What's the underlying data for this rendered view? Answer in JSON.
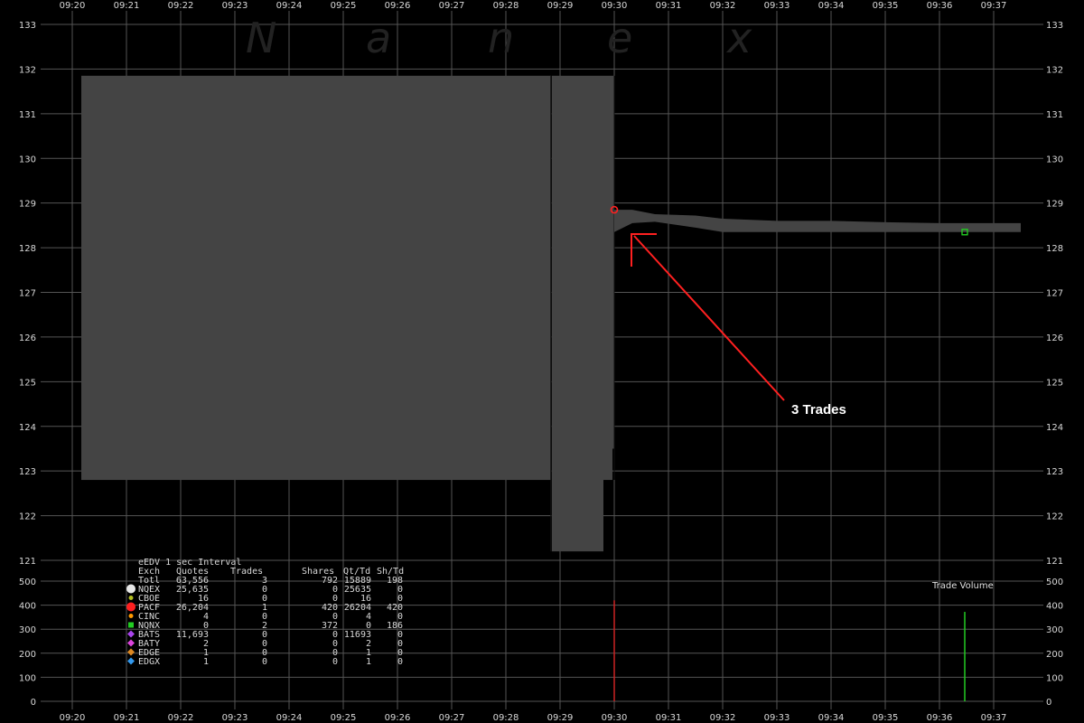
{
  "watermark": [
    "N",
    "a",
    "n",
    "e",
    "x"
  ],
  "chart_data": {
    "type": "scatter",
    "x_ticks": [
      "09:20",
      "09:21",
      "09:22",
      "09:23",
      "09:24",
      "09:25",
      "09:26",
      "09:27",
      "09:28",
      "09:29",
      "09:30",
      "09:31",
      "09:32",
      "09:33",
      "09:34",
      "09:35",
      "09:36",
      "09:37"
    ],
    "price_axis": {
      "ticks": [
        121,
        122,
        123,
        124,
        125,
        126,
        127,
        128,
        129,
        130,
        131,
        132,
        133
      ],
      "ylim": [
        120.9,
        133.2
      ]
    },
    "volume_axis": {
      "ticks": [
        0,
        100,
        200,
        300,
        400,
        500
      ],
      "ylim": [
        0,
        500
      ],
      "label": "Trade Volume"
    },
    "grid": true,
    "nbbo_spread_regions": [
      {
        "start": "09:20:10",
        "end": "09:28:50",
        "bid": 122.8,
        "ask": 131.85
      },
      {
        "start": "09:28:51",
        "end": "09:29:48",
        "bid": 121.2,
        "ask": 131.85
      },
      {
        "start": "09:29:48",
        "end": "09:29:58",
        "bid": 122.8,
        "ask": 131.85
      },
      {
        "start": "09:29:58",
        "end": "09:30:00",
        "bid": 123.5,
        "ask": 131.85
      }
    ],
    "nbbo_after_open": [
      {
        "t": "09:30:00",
        "bid": 128.35,
        "ask": 128.85
      },
      {
        "t": "09:30:20",
        "bid": 128.55,
        "ask": 128.85
      },
      {
        "t": "09:30:45",
        "bid": 128.58,
        "ask": 128.75
      },
      {
        "t": "09:31:30",
        "bid": 128.45,
        "ask": 128.72
      },
      {
        "t": "09:32:00",
        "bid": 128.35,
        "ask": 128.65
      },
      {
        "t": "09:33:00",
        "bid": 128.35,
        "ask": 128.6
      },
      {
        "t": "09:34:00",
        "bid": 128.35,
        "ask": 128.6
      },
      {
        "t": "09:35:00",
        "bid": 128.35,
        "ask": 128.57
      },
      {
        "t": "09:36:00",
        "bid": 128.35,
        "ask": 128.55
      },
      {
        "t": "09:37:30",
        "bid": 128.35,
        "ask": 128.55
      }
    ],
    "trades": [
      {
        "t": "09:30:00",
        "price": 128.85,
        "volume": 420,
        "exchange": "PACF",
        "marker": "circle",
        "color": "#ff2020"
      },
      {
        "t": "09:36:28",
        "price": 128.35,
        "volume": 186,
        "exchange": "NQNX",
        "marker": "square",
        "color": "#22cc22"
      },
      {
        "t": "09:36:28",
        "price": 128.35,
        "volume": 186,
        "exchange": "NQNX",
        "marker": "square",
        "color": "#22cc22"
      }
    ],
    "volume_bars": [
      {
        "t": "09:30:00",
        "volume": 420,
        "color": "#cc2222"
      },
      {
        "t": "09:36:28",
        "volume": 372,
        "color": "#22cc22"
      }
    ]
  },
  "annotation": {
    "text": "3 Trades",
    "color": "#ff2020"
  },
  "legend": {
    "title": "eEDV 1 sec Interval",
    "headers": [
      "Exch",
      "Quotes",
      "Trades",
      "Shares",
      "Qt/Td",
      "Sh/Td"
    ],
    "rows": [
      {
        "exch": "Totl",
        "quotes": "63,556",
        "trades": "3",
        "shares": "792",
        "qt_td": "15889",
        "sh_td": "198",
        "color": "",
        "marker": "none"
      },
      {
        "exch": "NQEX",
        "quotes": "25,635",
        "trades": "0",
        "shares": "0",
        "qt_td": "25635",
        "sh_td": "0",
        "color": "#e8e8e8",
        "marker": "circle-big"
      },
      {
        "exch": "CBOE",
        "quotes": "16",
        "trades": "0",
        "shares": "0",
        "qt_td": "16",
        "sh_td": "0",
        "color": "#b5c020",
        "marker": "circle"
      },
      {
        "exch": "PACF",
        "quotes": "26,204",
        "trades": "1",
        "shares": "420",
        "qt_td": "26204",
        "sh_td": "420",
        "color": "#ff2020",
        "marker": "circle-big"
      },
      {
        "exch": "CINC",
        "quotes": "4",
        "trades": "0",
        "shares": "0",
        "qt_td": "4",
        "sh_td": "0",
        "color": "#ff9900",
        "marker": "circle"
      },
      {
        "exch": "NQNX",
        "quotes": "0",
        "trades": "2",
        "shares": "372",
        "qt_td": "0",
        "sh_td": "186",
        "color": "#22cc22",
        "marker": "square"
      },
      {
        "exch": "BATS",
        "quotes": "11,693",
        "trades": "0",
        "shares": "0",
        "qt_td": "11693",
        "sh_td": "0",
        "color": "#aa44ee",
        "marker": "diamond"
      },
      {
        "exch": "BATY",
        "quotes": "2",
        "trades": "0",
        "shares": "0",
        "qt_td": "2",
        "sh_td": "0",
        "color": "#dd44dd",
        "marker": "diamond"
      },
      {
        "exch": "EDGE",
        "quotes": "1",
        "trades": "0",
        "shares": "0",
        "qt_td": "1",
        "sh_td": "0",
        "color": "#dd8822",
        "marker": "diamond"
      },
      {
        "exch": "EDGX",
        "quotes": "1",
        "trades": "0",
        "shares": "0",
        "qt_td": "1",
        "sh_td": "0",
        "color": "#3399ee",
        "marker": "diamond"
      }
    ]
  },
  "colors": {
    "background": "#000000",
    "grid": "#555555",
    "spread": "#444444"
  }
}
